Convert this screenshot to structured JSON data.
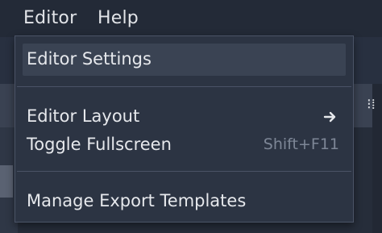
{
  "menubar": {
    "items": [
      {
        "label": "Editor"
      },
      {
        "label": "Help"
      }
    ]
  },
  "popup": {
    "items": [
      {
        "label": "Editor Settings",
        "shortcut": "",
        "submenu": false
      },
      {
        "label": "Editor Layout",
        "shortcut": "",
        "submenu": true
      },
      {
        "label": "Toggle Fullscreen",
        "shortcut": "Shift+F11",
        "submenu": false
      },
      {
        "label": "Manage Export Templates",
        "shortcut": "",
        "submenu": false
      }
    ]
  },
  "colors": {
    "menu_text": "#e2e4e8",
    "shortcut_text": "#7d8696",
    "popup_bg": "#2c3443",
    "hover_bg": "#3a4353"
  }
}
